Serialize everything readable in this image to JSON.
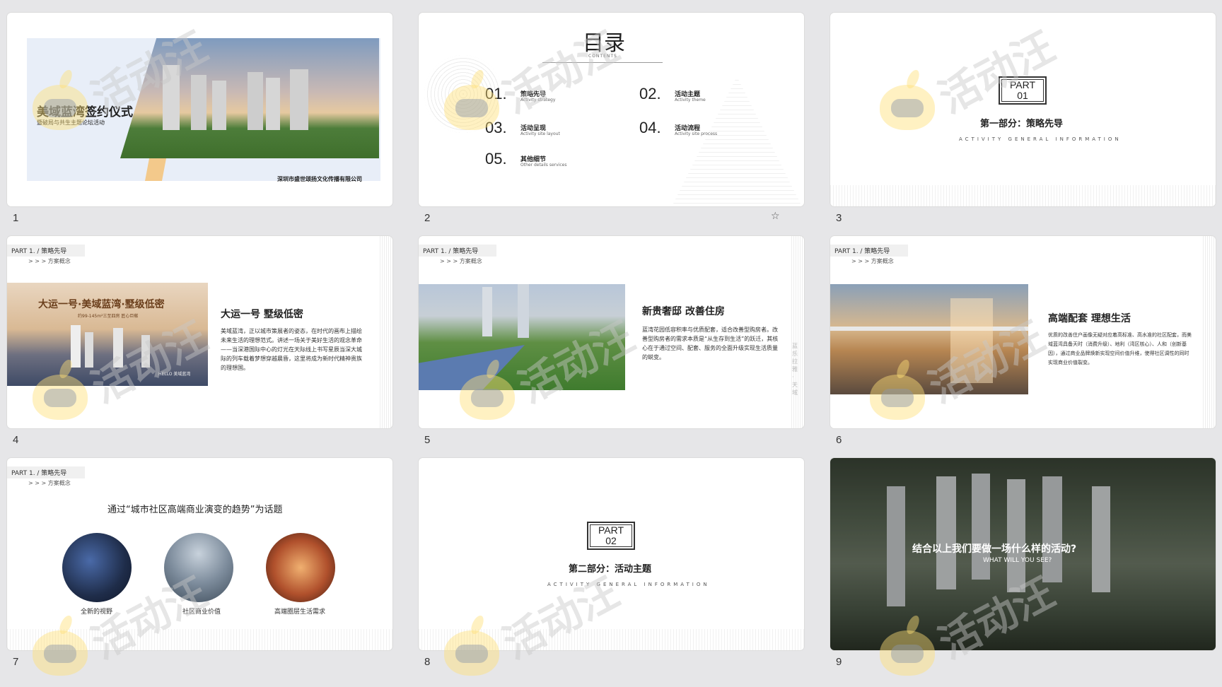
{
  "watermark": {
    "text": "活动汪"
  },
  "slides": [
    {
      "number": "1",
      "title": "美域蓝湾签约仪式",
      "subtitle": "暨破局与共生主题论坛活动",
      "company": "深圳市盛世颂扬文化传播有限公司"
    },
    {
      "number": "2",
      "heading": "目录",
      "heading_en": "CONTENTS",
      "items": [
        {
          "num": "01.",
          "cn": "策略先导",
          "en": "Activity strategy"
        },
        {
          "num": "02.",
          "cn": "活动主题",
          "en": "Activity theme"
        },
        {
          "num": "03.",
          "cn": "活动呈现",
          "en": "Activity site layout"
        },
        {
          "num": "04.",
          "cn": "活动流程",
          "en": "Activity site process"
        },
        {
          "num": "05.",
          "cn": "其他细节",
          "en": "Other details services"
        }
      ]
    },
    {
      "number": "3",
      "part": "PART\n01",
      "title": "第一部分：策略先导",
      "spaced": "ACTIVITY GENERAL INFORMATION"
    },
    {
      "number": "4",
      "tag": "PART 1. / 策略先导",
      "sub": "> > > 方案概念",
      "img_title": "大运一号·美域蓝湾·墅级低密",
      "img_sub": "约99-145m²三至四房 匠心巨献",
      "img_logo": "HELLO 美域蓝湾",
      "title": "大运一号  墅级低密",
      "para": "美域蓝湾，正以城市策展者的姿态，在时代的画布上描绘未来生活的理想范式。讲述一场关于美好生活的观念革命——当深港国际中心的灯光在天际线上书写星辰当深大城际的列车载着梦想穿越晨昏，这里将成为新时代精神贵族的理想国。"
    },
    {
      "number": "5",
      "tag": "PART 1. / 策略先导",
      "sub": "> > > 方案概念",
      "title": "新贵奢邸  改善住房",
      "para": "蓝湾花园低容积率与优质配套，适合改善型购房者。改善型购房者的需求本质是“从生存到生活”的跃迁，其核心在于通过空间、配套、服务的全面升级实现生活质量的蜕变。",
      "side": "蓝乐拉雅·天域"
    },
    {
      "number": "6",
      "tag": "PART 1. / 策略先导",
      "sub": "> > > 方案概念",
      "title": "高端配套  理想生活",
      "para": "优质的改善住户画像无疑对应着高标准、高水准的社区配套，而美域蓝湾具备天时（消费升级）、地利（湾区核心）、人和（创新基因），通过商业品牌焕新实现空间价值升维，使得社区调性的同时实现商业价值裂变。"
    },
    {
      "number": "7",
      "tag": "PART 1. / 策略先导",
      "sub": "> > > 方案概念",
      "title": "通过“城市社区高端商业演变的趋势”为话题",
      "captions": [
        "全新的视野",
        "社区商业价值",
        "高端圈层生活需求"
      ]
    },
    {
      "number": "8",
      "part": "PART\n02",
      "title": "第二部分：活动主题",
      "spaced": "ACTIVITY GENERAL INFORMATION"
    },
    {
      "number": "9",
      "title": "结合以上我们要做一场什么样的活动?",
      "subtitle": "WHAT WILL YOU SEE?"
    }
  ]
}
